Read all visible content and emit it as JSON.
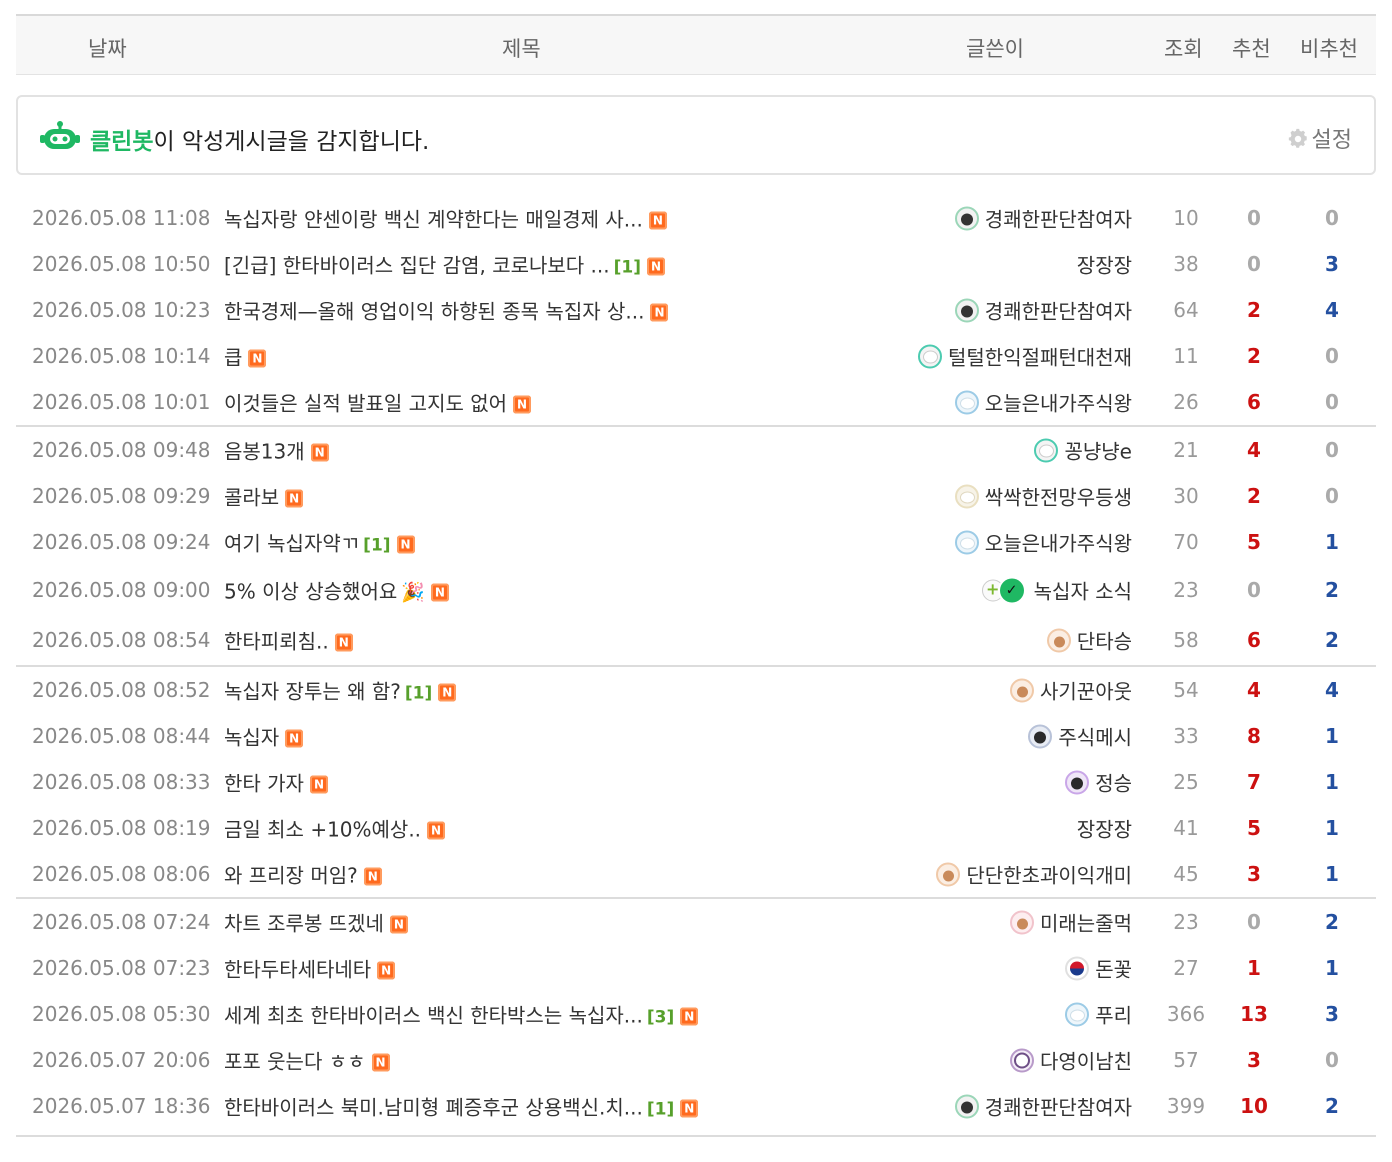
{
  "header": {
    "date": "날짜",
    "title": "제목",
    "author": "글쓴이",
    "views": "조회",
    "recommend": "추천",
    "not_recommend": "비추천"
  },
  "cleanbot": {
    "brand": "클린봇",
    "message": "이 악성게시글을 감지합니다.",
    "setting_label": "설정"
  },
  "new_badge": "N",
  "posts": [
    {
      "date": "2026.05.08 11:08",
      "title": "녹십자랑 얀센이랑 백신 계약한다는 매일경제 사...",
      "comments": "",
      "author": "경쾌한판단참여자",
      "avatar": "cat-icon",
      "views": "10",
      "rec": "0",
      "nrec": "0"
    },
    {
      "date": "2026.05.08 10:50",
      "title": "[긴급] 한타바이러스 집단 감염, 코로나보다 ...",
      "comments": "[1]",
      "author": "장장장",
      "avatar": "",
      "views": "38",
      "rec": "0",
      "nrec": "3"
    },
    {
      "date": "2026.05.08 10:23",
      "title": "한국경제—올해 영업이익 하향된 종목 녹집자 상...",
      "comments": "",
      "author": "경쾌한판단참여자",
      "avatar": "cat-icon",
      "views": "64",
      "rec": "2",
      "nrec": "4"
    },
    {
      "date": "2026.05.08 10:14",
      "title": "큽",
      "comments": "",
      "author": "털털한익절패턴대천재",
      "avatar": "sheep-icon",
      "views": "11",
      "rec": "2",
      "nrec": "0"
    },
    {
      "date": "2026.05.08 10:01",
      "title": "이것들은 실적 발표일 고지도 없어",
      "comments": "",
      "author": "오늘은내가주식왕",
      "avatar": "cloud-icon",
      "views": "26",
      "rec": "6",
      "nrec": "0"
    },
    {
      "date": "2026.05.08 09:48",
      "title": "음봉13개",
      "comments": "",
      "author": "꽁냥냥e",
      "avatar": "sheep-icon",
      "views": "21",
      "rec": "4",
      "nrec": "0"
    },
    {
      "date": "2026.05.08 09:29",
      "title": "콜라보",
      "comments": "",
      "author": "싹싹한전망우등생",
      "avatar": "cream-icon",
      "views": "30",
      "rec": "2",
      "nrec": "0"
    },
    {
      "date": "2026.05.08 09:24",
      "title": "여기 녹십자약ㄲ",
      "comments": "[1]",
      "author": "오늘은내가주식왕",
      "avatar": "cloud-icon",
      "views": "70",
      "rec": "5",
      "nrec": "1"
    },
    {
      "date": "2026.05.08 09:00",
      "title": "5% 이상 상승했어요",
      "comments": "",
      "party": "🎉",
      "author": "녹십자 소식",
      "avatar": "news-icon",
      "views": "23",
      "rec": "0",
      "nrec": "2"
    },
    {
      "date": "2026.05.08 08:54",
      "title": "한타피뢰침..",
      "comments": "",
      "author": "단타승",
      "avatar": "bear-icon",
      "views": "58",
      "rec": "6",
      "nrec": "2"
    },
    {
      "date": "2026.05.08 08:52",
      "title": "녹십자 장투는 왜 함?",
      "comments": "[1]",
      "author": "사기꾼아웃",
      "avatar": "bear-icon",
      "views": "54",
      "rec": "4",
      "nrec": "4"
    },
    {
      "date": "2026.05.08 08:44",
      "title": "녹십자",
      "comments": "",
      "author": "주식메시",
      "avatar": "dark-icon",
      "views": "33",
      "rec": "8",
      "nrec": "1"
    },
    {
      "date": "2026.05.08 08:33",
      "title": "한타 가자",
      "comments": "",
      "author": "정승",
      "avatar": "purple-icon",
      "views": "25",
      "rec": "7",
      "nrec": "1"
    },
    {
      "date": "2026.05.08 08:19",
      "title": "금일 최소 +10%예상..",
      "comments": "",
      "author": "장장장",
      "avatar": "",
      "views": "41",
      "rec": "5",
      "nrec": "1"
    },
    {
      "date": "2026.05.08 08:06",
      "title": "와 프리장 머임?",
      "comments": "",
      "author": "단단한초과이익개미",
      "avatar": "bear-icon",
      "views": "45",
      "rec": "3",
      "nrec": "1"
    },
    {
      "date": "2026.05.08 07:24",
      "title": "차트 조루봉 뜨겠네",
      "comments": "",
      "author": "미래는줄먹",
      "avatar": "pinkbear-icon",
      "views": "23",
      "rec": "0",
      "nrec": "2"
    },
    {
      "date": "2026.05.08 07:23",
      "title": "한타두타세타네타",
      "comments": "",
      "author": "돈꽃",
      "avatar": "flag-icon",
      "views": "27",
      "rec": "1",
      "nrec": "1"
    },
    {
      "date": "2026.05.08 05:30",
      "title": "세계 최초 한타바이러스 백신 한타박스는 녹십자...",
      "comments": "[3]",
      "author": "푸리",
      "avatar": "cloud-icon",
      "views": "366",
      "rec": "13",
      "nrec": "3"
    },
    {
      "date": "2026.05.07 20:06",
      "title": "포포 웃는다 ㅎㅎ",
      "comments": "",
      "author": "다영이남친",
      "avatar": "girl-icon",
      "views": "57",
      "rec": "3",
      "nrec": "0"
    },
    {
      "date": "2026.05.07 18:36",
      "title": "한타바이러스 북미.남미형 폐증후군 상용백신.치...",
      "comments": "[1]",
      "author": "경쾌한판단참여자",
      "avatar": "cat-icon",
      "views": "399",
      "rec": "10",
      "nrec": "2"
    }
  ],
  "colors": {
    "brand_green": "#1fb863",
    "rec_red": "#cc1111",
    "nrec_blue": "#2450a0",
    "comment_green": "#57a02b",
    "new_orange": "#ff6a1e"
  }
}
